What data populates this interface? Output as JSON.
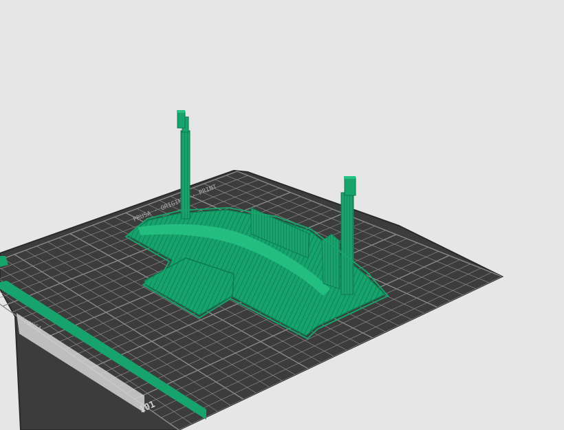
{
  "viewport": {
    "name": "3D slicer preview",
    "background": "#e6e6e6"
  },
  "bed": {
    "surface_color": "#3c3c3c",
    "grid_color": "#8a8a8a",
    "edge_color": "#2a2a2a",
    "labels": {
      "top_edge_text": "PRUSA · ORIGINAL · PRINT",
      "left_edge_text": "PRUSA",
      "corner_mark": "101"
    }
  },
  "model": {
    "color": "#17a36c",
    "highlight": "#27c385",
    "shadow": "#0d7a4f",
    "description_icon": "sliced-model-icon"
  }
}
